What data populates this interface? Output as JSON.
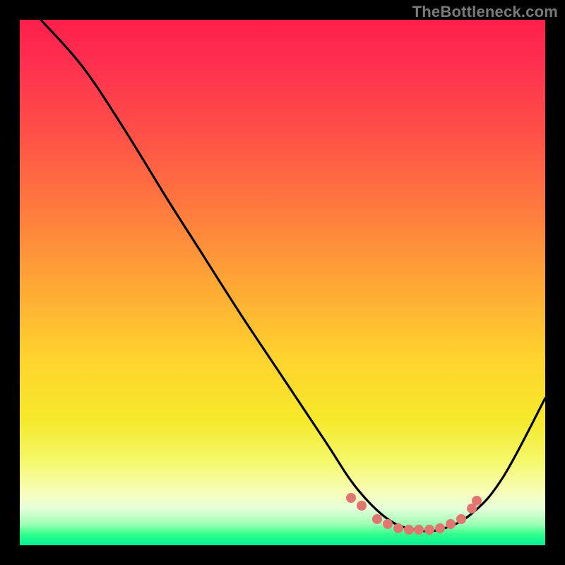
{
  "watermark": "TheBottleneck.com",
  "chart_data": {
    "type": "line",
    "title": "",
    "xlabel": "",
    "ylabel": "",
    "xlim": [
      0,
      100
    ],
    "ylim": [
      0,
      100
    ],
    "grid": false,
    "legend": false,
    "background_gradient": {
      "direction": "vertical",
      "stops": [
        {
          "pos": 0.0,
          "color": "#ff1f4b"
        },
        {
          "pos": 0.22,
          "color": "#ff5147"
        },
        {
          "pos": 0.5,
          "color": "#ffa636"
        },
        {
          "pos": 0.76,
          "color": "#f6e92a"
        },
        {
          "pos": 0.9,
          "color": "#f8fdb9"
        },
        {
          "pos": 0.96,
          "color": "#9cffb4"
        },
        {
          "pos": 1.0,
          "color": "#00ef92"
        }
      ]
    },
    "series": [
      {
        "name": "bottleneck-curve",
        "x": [
          4,
          12,
          20,
          28,
          35,
          42,
          50,
          58,
          64,
          70,
          75,
          80,
          86,
          92,
          100
        ],
        "values": [
          100,
          91,
          79,
          66,
          55,
          44,
          32,
          20,
          11,
          5,
          3,
          3,
          6,
          13,
          28
        ]
      }
    ],
    "scatter_overlay": {
      "name": "valley-dots",
      "color": "#e1756f",
      "points": [
        {
          "x": 63,
          "y": 9
        },
        {
          "x": 65,
          "y": 7.5
        },
        {
          "x": 68,
          "y": 5
        },
        {
          "x": 70,
          "y": 4
        },
        {
          "x": 72,
          "y": 3.2
        },
        {
          "x": 74,
          "y": 3
        },
        {
          "x": 76,
          "y": 3
        },
        {
          "x": 78,
          "y": 3
        },
        {
          "x": 80,
          "y": 3.2
        },
        {
          "x": 82,
          "y": 4
        },
        {
          "x": 84,
          "y": 5
        },
        {
          "x": 86,
          "y": 7
        },
        {
          "x": 87,
          "y": 8.5
        }
      ]
    }
  }
}
